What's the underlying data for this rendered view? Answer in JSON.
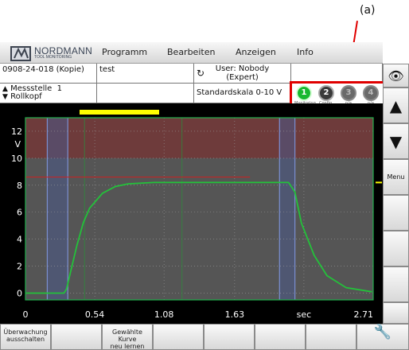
{
  "annotation": {
    "label": "(a)"
  },
  "logo": {
    "name": "NORDMANN",
    "tagline": "TOOL MONITORING"
  },
  "menu": [
    "Programm",
    "Bearbeiten",
    "Anzeigen",
    "Info"
  ],
  "info": {
    "project": "0908-24-018 (Kopie)",
    "note": "test",
    "user_line1": "User: Nobody",
    "user_line2": "(Expert)",
    "station_label": "Messstelle",
    "station_number": "1",
    "station_sub": "Rollkopf",
    "scale": "Standardskala 0-10 V"
  },
  "leds": [
    {
      "num": "1",
      "label": "Monitoring",
      "state": "active"
    },
    {
      "num": "2",
      "label": "Config.",
      "state": "on"
    },
    {
      "num": "3",
      "label": "n/a",
      "state": "off"
    },
    {
      "num": "4",
      "label": "n/a",
      "state": "off"
    }
  ],
  "right_buttons": {
    "menu": "Menu"
  },
  "bottom_buttons": {
    "b1_line1": "Überwachung",
    "b1_line2": "ausschalten",
    "b3_line1": "Gewählte Kurve",
    "b3_line2": "neu lernen"
  },
  "colors": {
    "plot_bg": "#555555",
    "band_red": "#6e3b3b",
    "curve": "#23c23a",
    "frame": "#22b14c",
    "highlight": "#ffff00",
    "annotation": "#e00000"
  },
  "chart_data": {
    "type": "line",
    "ylabel": "V",
    "ylim": [
      -0.5,
      13
    ],
    "xlim": [
      0,
      2.71
    ],
    "xlabel": "sec",
    "x_ticks": [
      "0",
      "0.54",
      "1.08",
      "1.63",
      "sec",
      "2.71"
    ],
    "y_ticks": [
      "0",
      "2",
      "4",
      "6",
      "8",
      "10",
      "12"
    ],
    "red_band": [
      10,
      13
    ],
    "threshold_line": {
      "value": 8.6,
      "x_end": 1.75
    },
    "blue_windows": [
      [
        0.17,
        0.33
      ],
      [
        1.98,
        2.1
      ]
    ],
    "series": [
      {
        "x": [
          0,
          0.3,
          0.32,
          0.35,
          0.4,
          0.45,
          0.5,
          0.6,
          0.7,
          0.8,
          1.0,
          1.3,
          1.6,
          1.95,
          2.05,
          2.1,
          2.15,
          2.25,
          2.35,
          2.5,
          2.7
        ],
        "values": [
          0,
          0,
          0.3,
          1.5,
          3.5,
          5.2,
          6.3,
          7.4,
          7.9,
          8.1,
          8.2,
          8.2,
          8.2,
          8.2,
          8.2,
          7.5,
          5.2,
          2.8,
          1.3,
          0.4,
          0.1
        ]
      }
    ]
  }
}
